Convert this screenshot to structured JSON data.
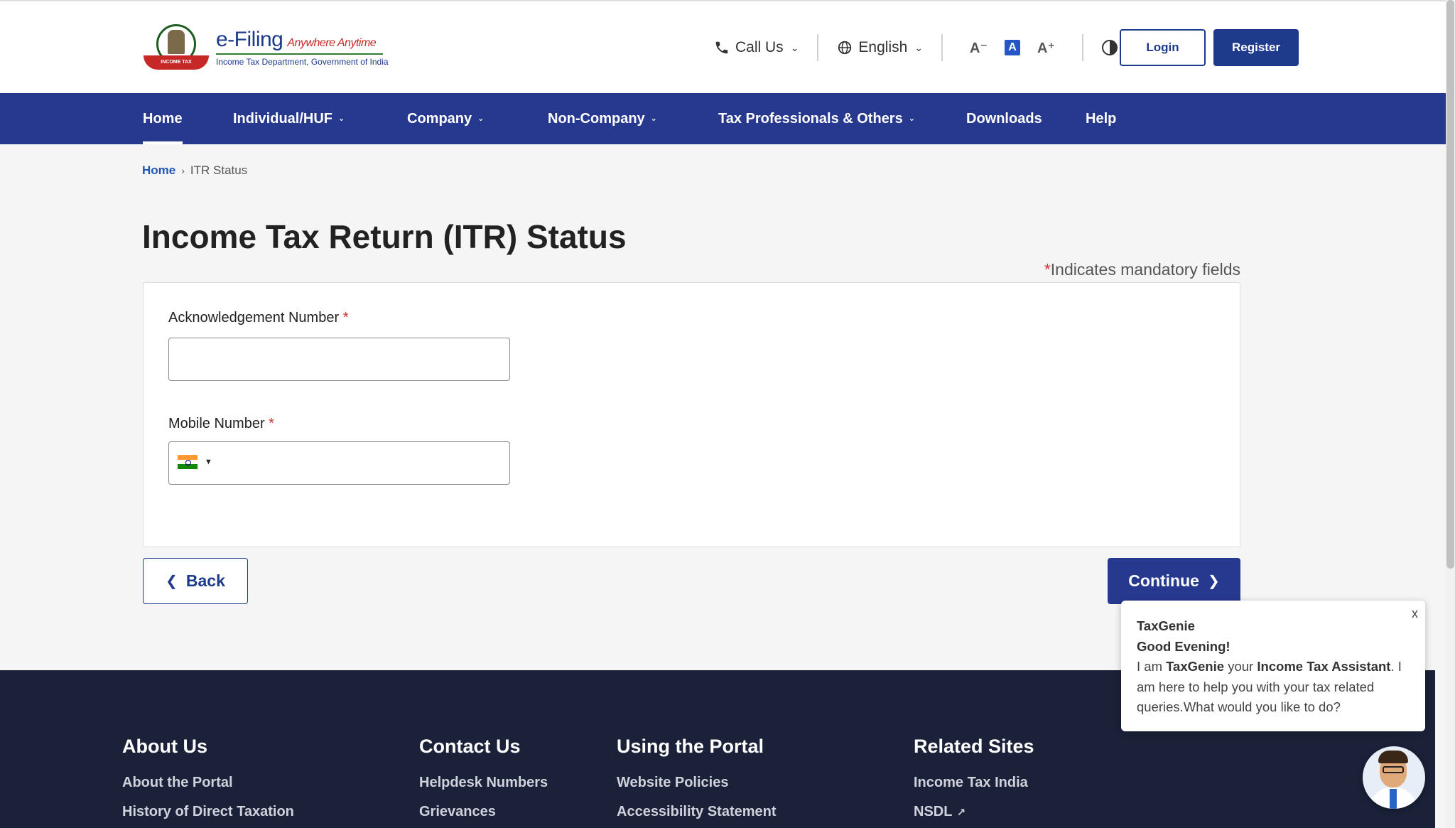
{
  "logo": {
    "title": "e-Filing",
    "tagline": "Anywhere Anytime",
    "subtitle": "Income Tax Department, Government of India",
    "emblem_text": "INCOME TAX DEPARTMENT"
  },
  "toolbar": {
    "call_us": "Call Us",
    "language": "English",
    "font_decrease": "A⁻",
    "font_default": "A",
    "font_increase": "A⁺",
    "login": "Login",
    "register": "Register"
  },
  "nav": {
    "items": [
      {
        "label": "Home",
        "active": true
      },
      {
        "label": "Individual/HUF"
      },
      {
        "label": "Company"
      },
      {
        "label": "Non-Company"
      },
      {
        "label": "Tax Professionals & Others"
      },
      {
        "label": "Downloads"
      },
      {
        "label": "Help"
      }
    ]
  },
  "breadcrumb": {
    "home": "Home",
    "current": "ITR Status"
  },
  "page": {
    "title": "Income Tax Return (ITR) Status",
    "mandatory_star": "*",
    "mandatory_note": "Indicates mandatory fields"
  },
  "form": {
    "ack_label": "Acknowledgement Number",
    "ack_value": "",
    "mobile_label": "Mobile Number",
    "mobile_value": "",
    "required_mark": "*"
  },
  "actions": {
    "back": "Back",
    "continue": "Continue"
  },
  "footer": {
    "about": {
      "heading": "About Us",
      "links": [
        "About the Portal",
        "History of Direct Taxation"
      ]
    },
    "contact": {
      "heading": "Contact Us",
      "links": [
        "Helpdesk Numbers",
        "Grievances"
      ]
    },
    "portal": {
      "heading": "Using the Portal",
      "links": [
        "Website Policies",
        "Accessibility Statement"
      ]
    },
    "related": {
      "heading": "Related Sites",
      "links": [
        "Income Tax India",
        "NSDL"
      ]
    }
  },
  "chat": {
    "close": "x",
    "name": "TaxGenie",
    "greeting": "Good Evening!",
    "msg_1": "I am",
    "msg_bot": "TaxGenie",
    "msg_2": "your",
    "msg_role": "Income Tax Assistant",
    "msg_3": ". I am here to help you with your tax related queries.What would you like to do?"
  },
  "colors": {
    "primary": "#27398f",
    "footer_bg": "#1a2138",
    "link": "#1e56b4",
    "required": "#d32f2f"
  }
}
